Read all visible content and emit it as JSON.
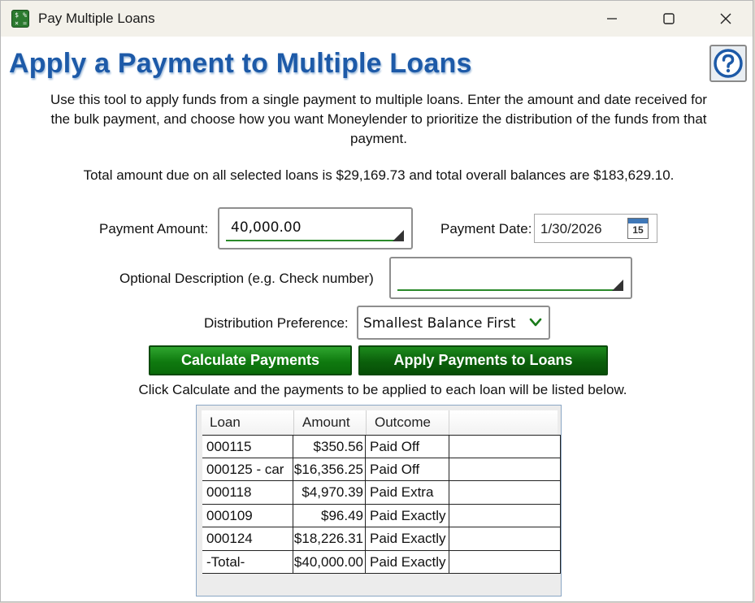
{
  "window": {
    "title": "Pay Multiple Loans",
    "minimize_icon": "minimize-icon",
    "maximize_icon": "maximize-icon",
    "close_icon": "close-icon"
  },
  "heading": "Apply a Payment to Multiple Loans",
  "help_icon": "question-mark-icon",
  "intro": "Use this tool to apply funds from a single payment to multiple loans. Enter the amount and date received for the bulk payment, and choose how you want Moneylender to prioritize the distribution of the funds from that payment.",
  "totals": "Total amount due on all selected loans is $29,169.73 and total overall balances are $183,629.10.",
  "form": {
    "payment_amount_label": "Payment Amount:",
    "payment_amount_value": "40,000.00",
    "payment_date_label": "Payment Date:",
    "payment_date_value": "1/30/2026",
    "calendar_day": "15",
    "description_label": "Optional Description (e.g. Check number)",
    "description_value": "",
    "distribution_label": "Distribution Preference:",
    "distribution_value": "Smallest Balance First"
  },
  "buttons": {
    "calculate": "Calculate Payments",
    "apply": "Apply Payments to Loans"
  },
  "hint": "Click Calculate and the payments to be applied to each loan will be listed below.",
  "table": {
    "columns": [
      "Loan",
      "Amount",
      "Outcome"
    ],
    "rows": [
      {
        "loan": "000115",
        "amount": "$350.56",
        "outcome": "Paid Off"
      },
      {
        "loan": "000125 - car",
        "amount": "$16,356.25",
        "outcome": "Paid Off"
      },
      {
        "loan": "000118",
        "amount": "$4,970.39",
        "outcome": "Paid Extra"
      },
      {
        "loan": "000109",
        "amount": "$96.49",
        "outcome": "Paid Exactly"
      },
      {
        "loan": "000124",
        "amount": "$18,226.31",
        "outcome": "Paid Exactly"
      },
      {
        "loan": "-Total-",
        "amount": "$40,000.00",
        "outcome": "Paid Exactly"
      }
    ]
  }
}
